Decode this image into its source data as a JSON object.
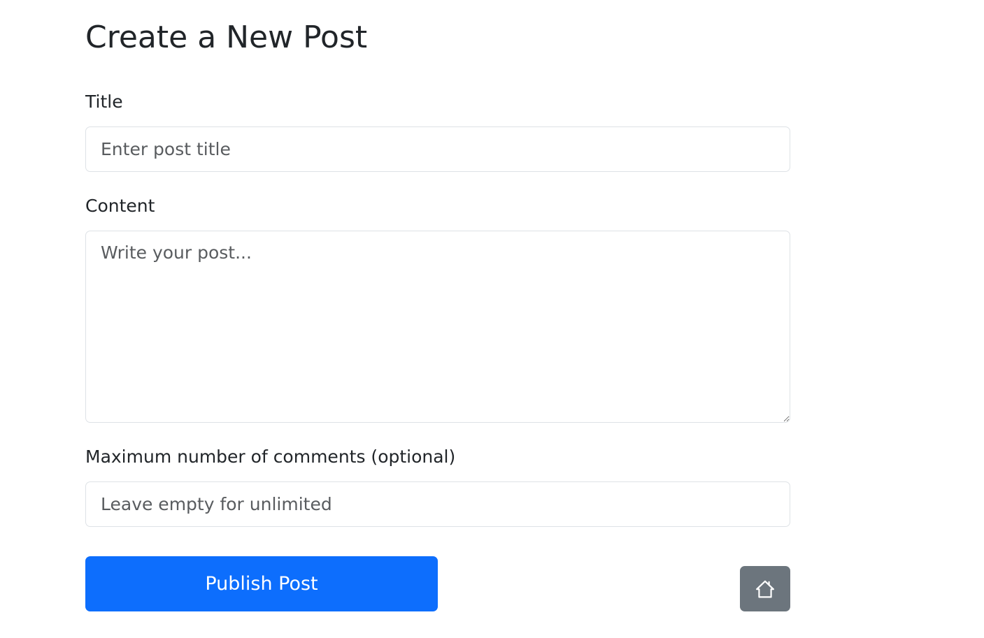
{
  "page": {
    "title": "Create a New Post"
  },
  "form": {
    "title_field": {
      "label": "Title",
      "value": "",
      "placeholder": "Enter post title"
    },
    "content_field": {
      "label": "Content",
      "value": "",
      "placeholder": "Write your post..."
    },
    "max_comments_field": {
      "label": "Maximum number of comments (optional)",
      "value": "",
      "placeholder": "Leave empty for unlimited"
    }
  },
  "actions": {
    "publish_label": "Publish Post",
    "home_icon": "house-icon"
  },
  "colors": {
    "primary": "#0d6efd",
    "secondary": "#6c757d",
    "text": "#212529",
    "border": "#dee2e6"
  }
}
